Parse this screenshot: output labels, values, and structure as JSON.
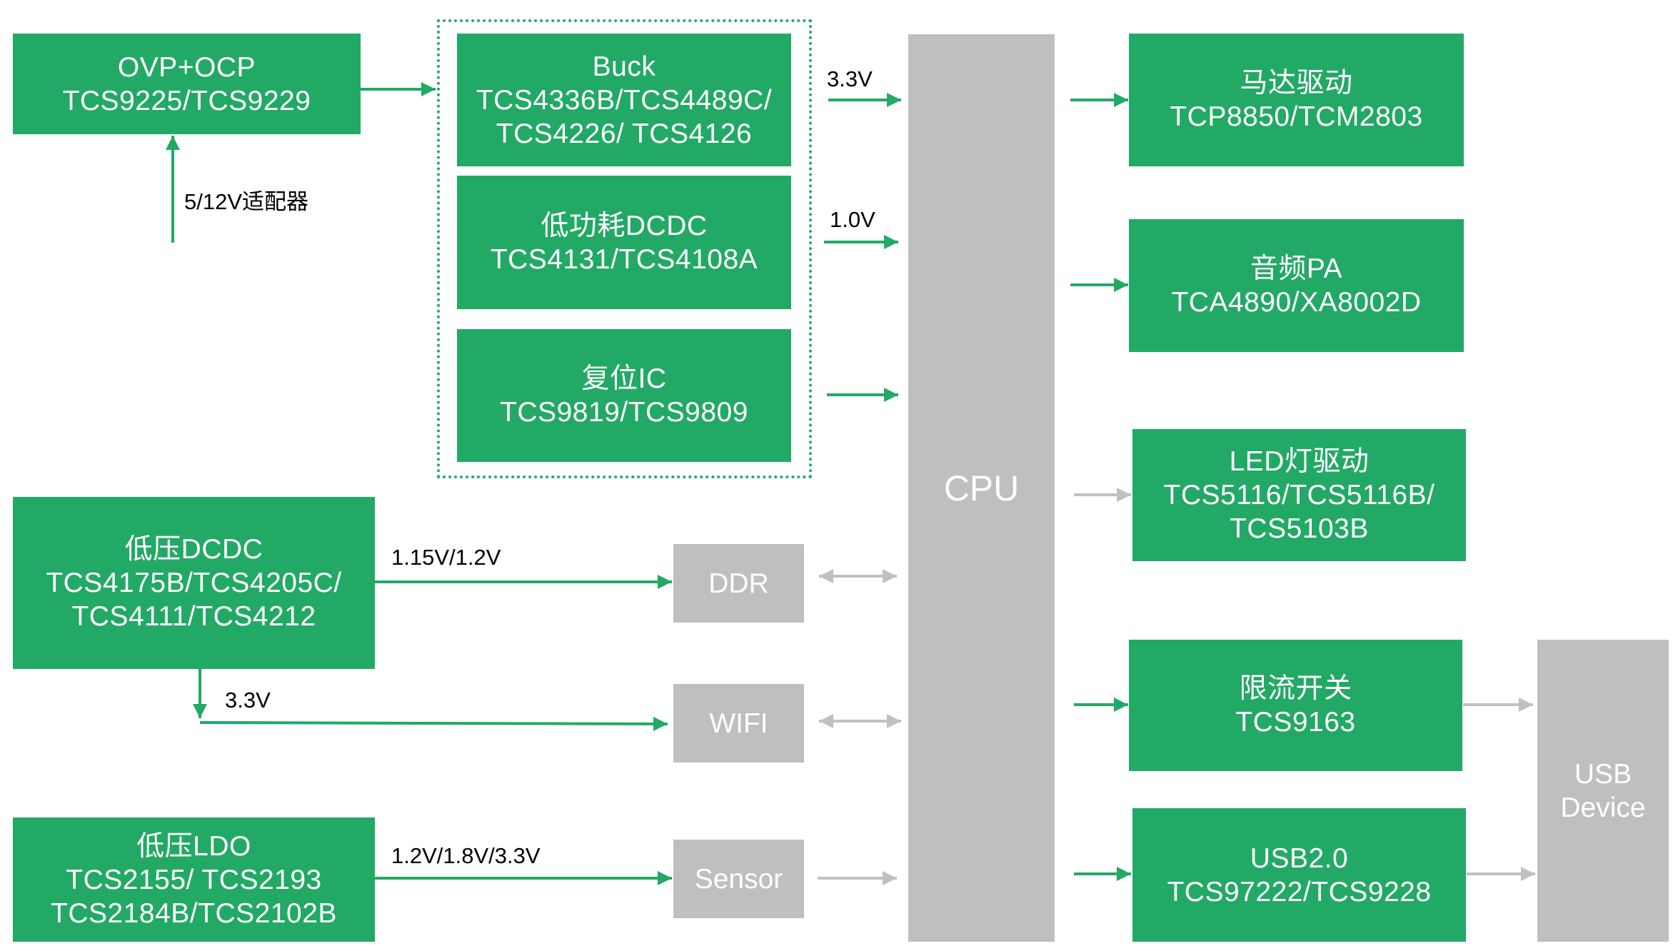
{
  "colors": {
    "green": "#23a966",
    "gray": "#bfbfbf",
    "arrow_green": "#23a966",
    "arrow_gray": "#c0c0c0"
  },
  "blocks": {
    "ovp": {
      "lines": [
        "OVP+OCP",
        "TCS9225/TCS9229"
      ]
    },
    "buck": {
      "lines": [
        "Buck",
        "TCS4336B/TCS4489C/",
        "TCS4226/ TCS4126"
      ]
    },
    "lp_dcdc": {
      "lines": [
        "低功耗DCDC",
        "TCS4131/TCS4108A"
      ]
    },
    "reset_ic": {
      "lines": [
        "复位IC",
        "TCS9819/TCS9809"
      ]
    },
    "lv_dcdc": {
      "lines": [
        "低压DCDC",
        "TCS4175B/TCS4205C/",
        "TCS4111/TCS4212"
      ]
    },
    "lv_ldo": {
      "lines": [
        "低压LDO",
        "TCS2155/ TCS2193",
        "TCS2184B/TCS2102B"
      ]
    },
    "cpu": {
      "label": "CPU"
    },
    "ddr": {
      "label": "DDR"
    },
    "wifi": {
      "label": "WIFI"
    },
    "sensor": {
      "label": "Sensor"
    },
    "motor": {
      "lines": [
        "马达驱动",
        "TCP8850/TCM2803"
      ]
    },
    "audio_pa": {
      "lines": [
        "音频PA",
        "TCA4890/XA8002D"
      ]
    },
    "led": {
      "lines": [
        "LED灯驱动",
        "TCS5116/TCS5116B/",
        "TCS5103B"
      ]
    },
    "current_switch": {
      "lines": [
        "限流开关",
        "TCS9163"
      ]
    },
    "usb20": {
      "lines": [
        "USB2.0",
        "TCS97222/TCS9228"
      ]
    },
    "usb_device": {
      "lines": [
        "USB",
        "Device"
      ]
    }
  },
  "labels": {
    "adapter": "5/12V适配器",
    "buck_out": "3.3V",
    "lp_dcdc_out": "1.0V",
    "ddr_rail": "1.15V/1.2V",
    "wifi_rail": "3.3V",
    "sensor_rail": "1.2V/1.8V/3.3V"
  }
}
